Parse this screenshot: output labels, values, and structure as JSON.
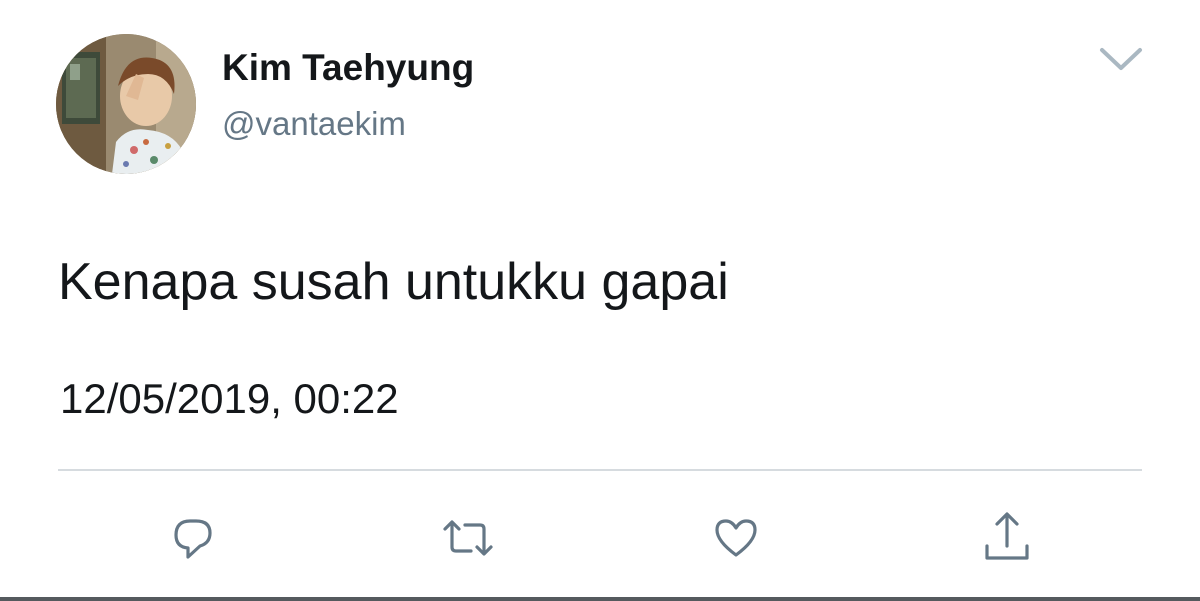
{
  "tweet": {
    "author": {
      "display_name": "Kim Taehyung",
      "handle": "@vantaekim",
      "avatar": "profile-photo"
    },
    "text": "Kenapa susah untukku gapai",
    "timestamp": "12/05/2019, 00:22"
  },
  "icons": {
    "menu": "chevron-down-icon",
    "reply": "reply-icon",
    "retweet": "retweet-icon",
    "like": "heart-icon",
    "share": "share-icon"
  },
  "colors": {
    "text_primary": "#14171a",
    "text_secondary": "#657786",
    "icon": "#657786",
    "divider": "#d6dbdf"
  }
}
